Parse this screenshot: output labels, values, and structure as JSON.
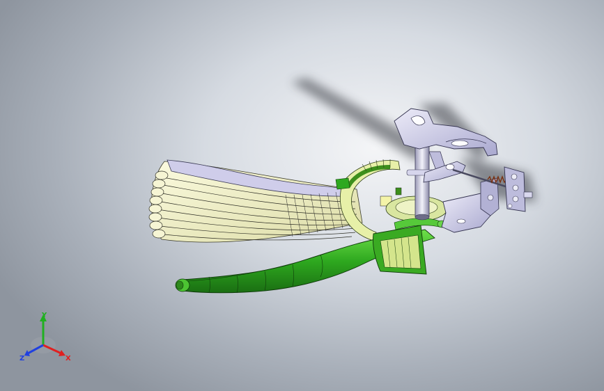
{
  "viewport": {
    "background": {
      "center": "#f4f5f7",
      "mid": "#d6dbe2",
      "edge": "#8e959f"
    }
  },
  "model": {
    "fan_color": "#f1f0c6",
    "lever_color": "#2ea81f",
    "bracket_color": "#c9c8e4"
  },
  "triad": {
    "x_label": "X",
    "y_label": "Y",
    "z_label": "Z",
    "colors": {
      "x": "#e02020",
      "y": "#20b020",
      "z": "#2040e0"
    }
  }
}
